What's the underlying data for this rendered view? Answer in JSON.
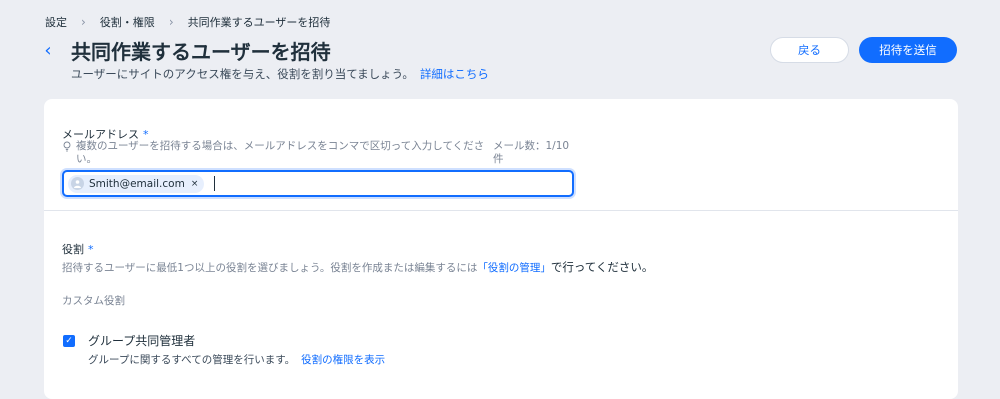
{
  "breadcrumb": {
    "items": [
      "設定",
      "役割・権限",
      "共同作業するユーザーを招待"
    ]
  },
  "header": {
    "title": "共同作業するユーザーを招待",
    "subtitle": "ユーザーにサイトのアクセス権を与え、役割を割り当てましょう。",
    "subtitle_link": "詳細はこちら",
    "back_label": "戻る",
    "send_label": "招待を送信"
  },
  "email": {
    "label": "メールアドレス",
    "required_mark": "*",
    "hint": "複数のユーザーを招待する場合は、メールアドレスをコンマで区切って入力してください。",
    "count": "メール数：1/10件",
    "chips": [
      "Smith@email.com"
    ],
    "chip_remove": "×"
  },
  "role": {
    "label": "役割",
    "required_mark": "*",
    "description": "招待するユーザーに最低1つ以上の役割を選びましょう。役割を作成または編集するには",
    "manage_link": "「役割の管理」",
    "description_end": "で行ってください。",
    "custom_heading": "カスタム役割",
    "items": [
      {
        "name": "グループ共同管理者",
        "description": "グループに関するすべての管理を行います。",
        "link": "役割の権限を表示",
        "checked": true
      }
    ]
  },
  "colors": {
    "accent": "#116dff",
    "background": "#eceef3"
  }
}
